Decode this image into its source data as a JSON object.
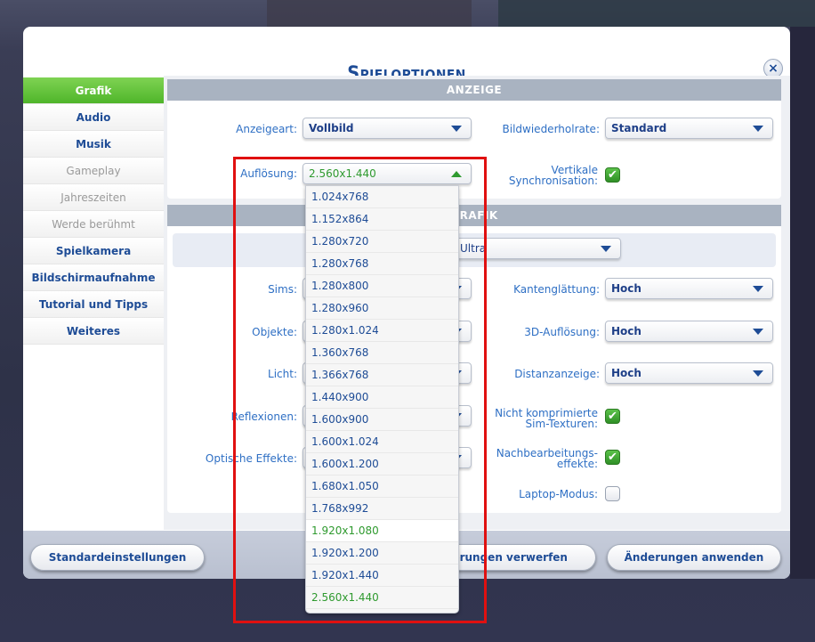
{
  "dialog": {
    "title": "Spieloptionen",
    "close_icon": "×"
  },
  "sidebar": {
    "items": [
      {
        "label": "Grafik",
        "state": "active"
      },
      {
        "label": "Audio",
        "state": "normal"
      },
      {
        "label": "Musik",
        "state": "normal"
      },
      {
        "label": "Gameplay",
        "state": "disabled"
      },
      {
        "label": "Jahreszeiten",
        "state": "disabled"
      },
      {
        "label": "Werde berühmt",
        "state": "disabled"
      },
      {
        "label": "Spielkamera",
        "state": "normal"
      },
      {
        "label": "Bildschirmaufnahme",
        "state": "normal"
      },
      {
        "label": "Tutorial und Tipps",
        "state": "normal"
      },
      {
        "label": "Weiteres",
        "state": "normal"
      }
    ]
  },
  "anzeige": {
    "header": "ANZEIGE",
    "anzeigeart": {
      "label": "Anzeigeart:",
      "value": "Vollbild"
    },
    "bildwiederholrate": {
      "label": "Bildwiederholrate:",
      "value": "Standard"
    },
    "aufloesung": {
      "label": "Auflösung:",
      "value": "2.560x1.440"
    },
    "vsync": {
      "label_line1": "Vertikale",
      "label_line2": "Synchronisation:",
      "checked": true
    }
  },
  "grafik": {
    "header": "GRAFIK",
    "preset": {
      "value": "Ultra"
    },
    "sims": {
      "label": "Sims:"
    },
    "objekte": {
      "label": "Objekte:"
    },
    "licht": {
      "label": "Licht:"
    },
    "reflexionen": {
      "label": "Reflexionen:"
    },
    "optische_effekte": {
      "label": "Optische Effekte:"
    },
    "kantenglaettung": {
      "label": "Kantenglättung:",
      "value": "Hoch"
    },
    "aufloesung_3d": {
      "label": "3D-Auflösung:",
      "value": "Hoch"
    },
    "distanzanzeige": {
      "label": "Distanzanzeige:",
      "value": "Hoch"
    },
    "unkomprimiert": {
      "label_line1": "Nicht komprimierte",
      "label_line2": "Sim-Texturen:",
      "checked": true
    },
    "nachbearbeitung": {
      "label_line1": "Nachbearbeitungs-",
      "label_line2": "effekte:",
      "checked": true
    },
    "laptop": {
      "label": "Laptop-Modus:",
      "checked": false
    }
  },
  "resolution_dropdown": {
    "options": [
      "1.024x768",
      "1.152x864",
      "1.280x720",
      "1.280x768",
      "1.280x800",
      "1.280x960",
      "1.280x1.024",
      "1.360x768",
      "1.366x768",
      "1.440x900",
      "1.600x900",
      "1.600x1.024",
      "1.600x1.200",
      "1.680x1.050",
      "1.768x992",
      "1.920x1.080",
      "1.920x1.200",
      "1.920x1.440",
      "2.560x1.440"
    ],
    "hover": "1.920x1.080",
    "selected": "2.560x1.440"
  },
  "footer": {
    "defaults": "Standardeinstellungen",
    "discard": "Änderungen verwerfen",
    "apply": "Änderungen anwenden"
  },
  "checkmark_icon": "✔"
}
